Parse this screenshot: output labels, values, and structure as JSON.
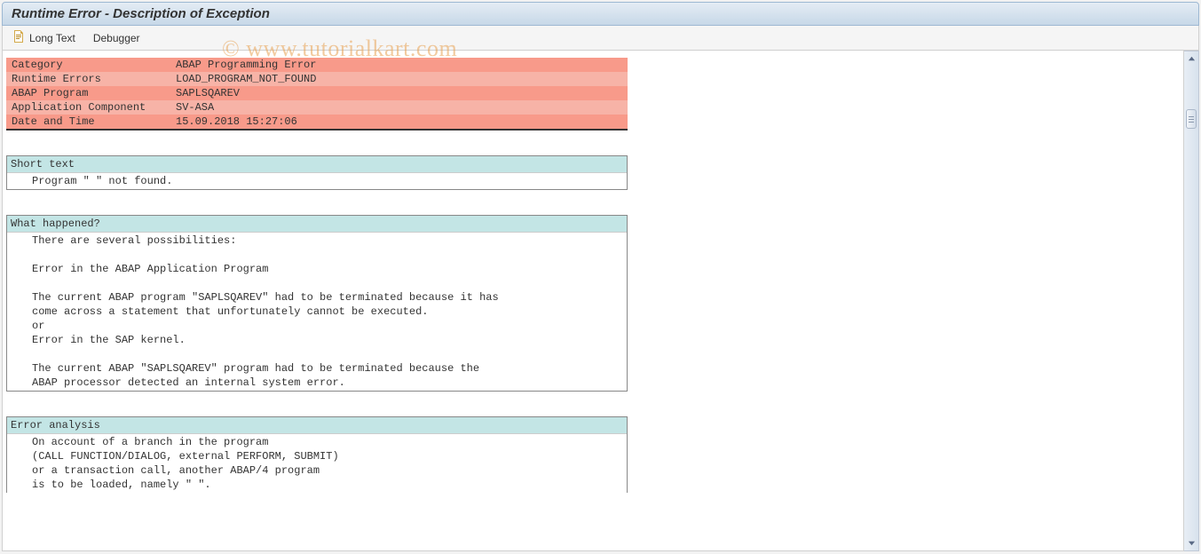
{
  "title": "Runtime Error - Description of Exception",
  "toolbar": {
    "longtext": "Long Text",
    "debugger": "Debugger"
  },
  "info": [
    {
      "label": "Category",
      "value": "ABAP Programming Error"
    },
    {
      "label": "Runtime Errors",
      "value": "LOAD_PROGRAM_NOT_FOUND"
    },
    {
      "label": "ABAP Program",
      "value": "SAPLSQAREV"
    },
    {
      "label": "Application Component",
      "value": "SV-ASA"
    },
    {
      "label": "Date and Time",
      "value": "15.09.2018 15:27:06"
    }
  ],
  "sections": {
    "shorttext": {
      "header": "Short text",
      "lines": [
        "Program \" \" not found."
      ]
    },
    "whathappened": {
      "header": "What happened?",
      "lines": [
        "There are several possibilities:",
        "",
        "Error in the ABAP Application Program",
        "",
        "The current ABAP program \"SAPLSQAREV\" had to be terminated because it has",
        "come across a statement that unfortunately cannot be executed.",
        "or",
        "Error in the SAP kernel.",
        "",
        "The current ABAP \"SAPLSQAREV\" program had to be terminated because the",
        "ABAP processor detected an internal system error."
      ]
    },
    "erroranalysis": {
      "header": "Error analysis",
      "lines": [
        "On account of a branch in the program",
        "(CALL FUNCTION/DIALOG, external PERFORM, SUBMIT)",
        "or a transaction call, another ABAP/4 program",
        "is to be loaded, namely \" \"."
      ]
    }
  },
  "watermark": "© www.tutorialkart.com"
}
